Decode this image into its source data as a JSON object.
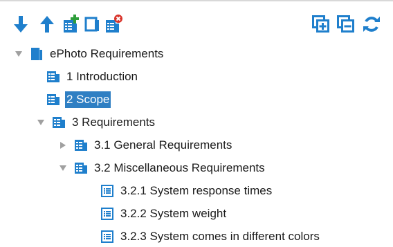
{
  "toolbar": {
    "left_icons": [
      "arrow-down-icon",
      "arrow-up-icon",
      "add-requirement-icon",
      "document-icon",
      "delete-requirement-icon"
    ],
    "right_icons": [
      "expand-all-icon",
      "collapse-all-icon",
      "refresh-icon"
    ]
  },
  "colors": {
    "accent": "#1f7fcc",
    "add_green": "#2e9e3a",
    "delete_red": "#d9342b",
    "selection": "#2f7fc3",
    "toggle_gray": "#a0a0a0"
  },
  "tree": {
    "root": {
      "label": "ePhoto Requirements",
      "expanded": true
    },
    "items": [
      {
        "label": "1 Introduction"
      },
      {
        "label": "2 Scope",
        "selected": true
      },
      {
        "label": "3 Requirements",
        "expanded": true
      },
      {
        "label": "3.1 General Requirements",
        "expanded": false
      },
      {
        "label": "3.2 Miscellaneous Requirements",
        "expanded": true
      },
      {
        "label": "3.2.1 System response times"
      },
      {
        "label": "3.2.2 System weight"
      },
      {
        "label": "3.2.3 System comes in different colors"
      }
    ]
  }
}
